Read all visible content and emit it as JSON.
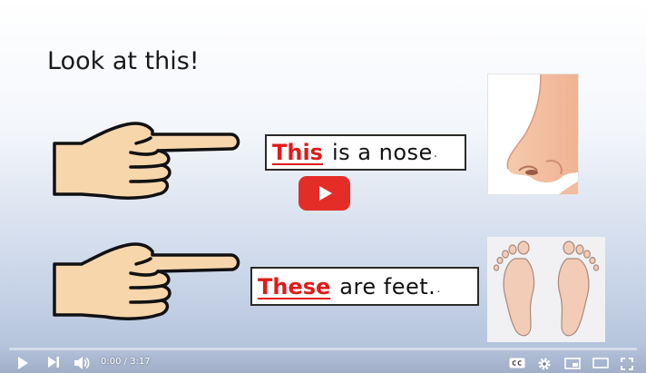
{
  "slide": {
    "heading": "Look at this!",
    "sentences": [
      {
        "keyword": "This",
        "rest": "is a nose",
        "terminator": "."
      },
      {
        "keyword": "These",
        "rest": "are feet.",
        "terminator": "."
      }
    ]
  },
  "player": {
    "time_current": "0:00",
    "time_separator": " / ",
    "time_total": "3:17",
    "played_fraction": 0,
    "brand_red": "#e52d27",
    "icons": [
      "play-icon",
      "next-icon",
      "volume-icon",
      "cc-icon",
      "gear-icon",
      "miniplayer-icon",
      "theater-icon",
      "fullscreen-icon"
    ]
  }
}
